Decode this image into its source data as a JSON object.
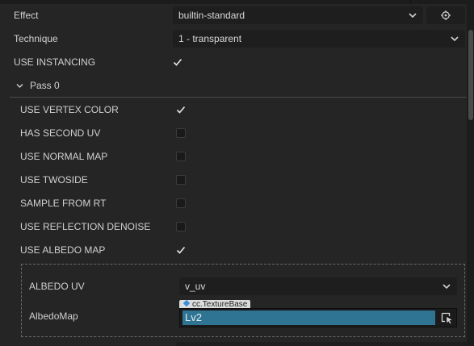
{
  "effect": {
    "label": "Effect",
    "value": "builtin-standard",
    "locate_icon": "locate-icon"
  },
  "technique": {
    "label": "Technique",
    "value": "1 - transparent"
  },
  "use_instancing": {
    "label": "USE INSTANCING",
    "checked": true
  },
  "pass": {
    "label": "Pass 0",
    "expanded": true
  },
  "pass_options": [
    {
      "label": "USE VERTEX COLOR",
      "checked": true
    },
    {
      "label": "HAS SECOND UV",
      "checked": false
    },
    {
      "label": "USE NORMAL MAP",
      "checked": false
    },
    {
      "label": "USE TWOSIDE",
      "checked": false
    },
    {
      "label": "SAMPLE FROM RT",
      "checked": false
    },
    {
      "label": "USE REFLECTION DENOISE",
      "checked": false
    },
    {
      "label": "USE ALBEDO MAP",
      "checked": true
    }
  ],
  "albedo": {
    "uv_label": "ALBEDO UV",
    "uv_value": "v_uv",
    "map_label": "AlbedoMap",
    "map_type": "cc.TextureBase",
    "map_value": "Lv2"
  },
  "colors": {
    "background": "#252525",
    "field": "#1e1e1e",
    "asset_selected": "#2f7593",
    "type_badge": "#dcdcdc"
  }
}
